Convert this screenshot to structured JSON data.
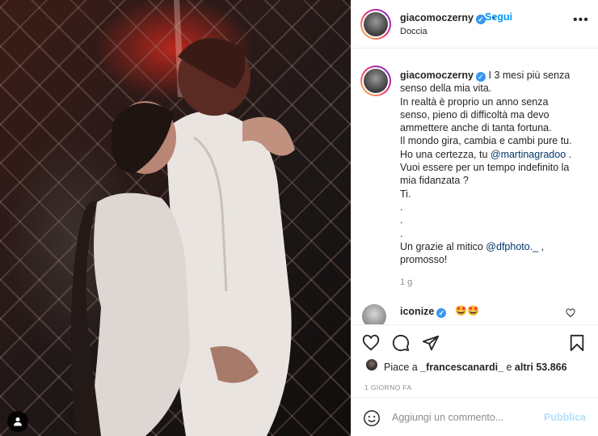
{
  "post": {
    "photo_alt": "Couple under a shower"
  },
  "header": {
    "username": "giacomoczerny",
    "separator": "•",
    "follow_label": "Segui",
    "location": "Doccia",
    "more_label": "•••"
  },
  "caption": {
    "username": "giacomoczerny",
    "lines": [
      "I 3 mesi più senza",
      "senso della mia vita.",
      "In realtà è proprio un anno senza",
      "senso, pieno di difficoltà ma devo",
      "ammettere anche di tanta fortuna.",
      "Il mondo gira, cambia e cambi pure tu.",
      "Ho una certezza, tu ",
      "Vuoi essere per un tempo indefinito la",
      "mia fidanzata ?",
      "Ti.",
      ".",
      ".",
      ".",
      "Un grazie al mitico ",
      "promosso!"
    ],
    "mention_1": "@martinagradoo",
    "mention_1_suffix": " .",
    "mention_2": "@dfphoto._",
    "mention_2_suffix": " ,",
    "time": "1 g"
  },
  "comment": {
    "username": "iconize",
    "text": "🤩🤩"
  },
  "likes": {
    "prefix": "Piace a ",
    "user": "_francescanardi_",
    "middle": " e ",
    "others": "altri 53.866"
  },
  "timeago": "1 GIORNO FA",
  "add_comment": {
    "placeholder": "Aggiungi un commento...",
    "publish_label": "Pubblica"
  },
  "colors": {
    "accent": "#0095f6",
    "verified": "#3897f0",
    "publish_disabled": "#b2dffc",
    "muted_text": "#8e8e8e"
  }
}
